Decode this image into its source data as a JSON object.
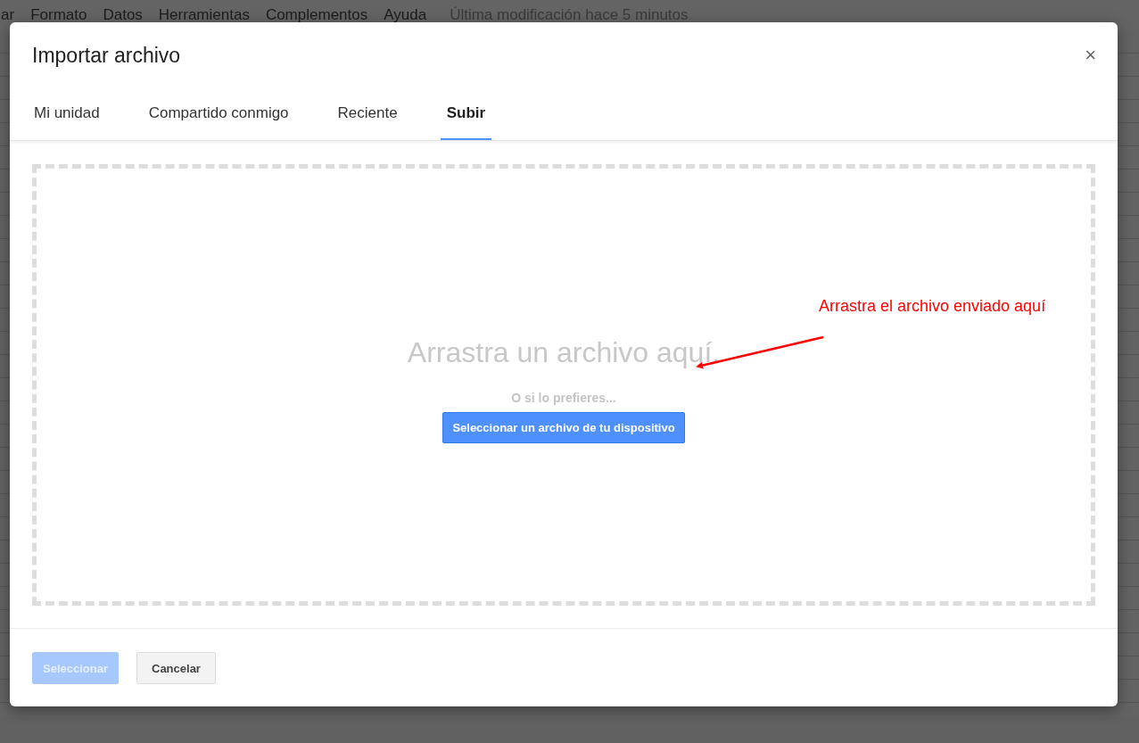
{
  "menu_bar": {
    "items": [
      "ar",
      "Formato",
      "Datos",
      "Herramientas",
      "Complementos",
      "Ayuda"
    ],
    "last_edit": "Última modificación hace 5 minutos"
  },
  "dialog": {
    "title": "Importar archivo",
    "close": "×",
    "tabs": [
      {
        "label": "Mi unidad",
        "selected": false
      },
      {
        "label": "Compartido conmigo",
        "selected": false
      },
      {
        "label": "Reciente",
        "selected": false
      },
      {
        "label": "Subir",
        "selected": true
      }
    ],
    "drop_zone": {
      "heading": "Arrastra un archivo aquí.",
      "alternative": "O si lo prefieres...",
      "button": "Seleccionar un archivo de tu dispositivo"
    },
    "buttons": [
      {
        "label": "Seleccionar",
        "kind": "primary",
        "disabled": true
      },
      {
        "label": "Cancelar",
        "kind": "secondary",
        "disabled": false
      }
    ]
  },
  "annotation": {
    "text": "Arrastra el archivo enviado aquí"
  }
}
